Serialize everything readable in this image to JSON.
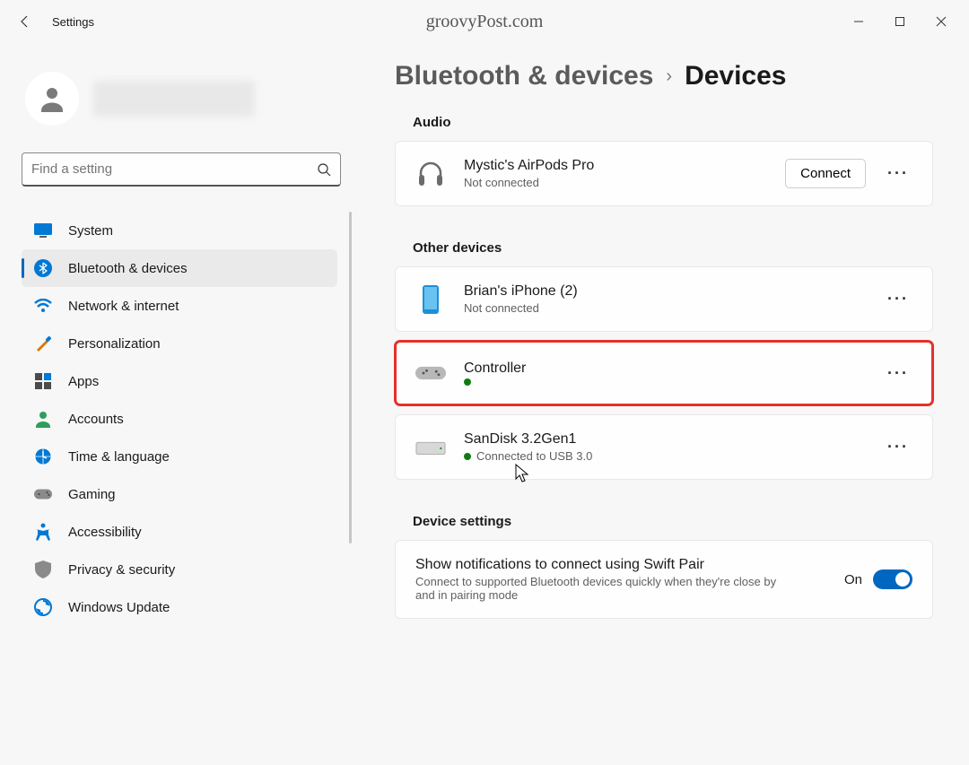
{
  "app_title": "Settings",
  "watermark": "groovyPost.com",
  "search": {
    "placeholder": "Find a setting"
  },
  "nav": {
    "items": [
      {
        "label": "System"
      },
      {
        "label": "Bluetooth & devices"
      },
      {
        "label": "Network & internet"
      },
      {
        "label": "Personalization"
      },
      {
        "label": "Apps"
      },
      {
        "label": "Accounts"
      },
      {
        "label": "Time & language"
      },
      {
        "label": "Gaming"
      },
      {
        "label": "Accessibility"
      },
      {
        "label": "Privacy & security"
      },
      {
        "label": "Windows Update"
      }
    ]
  },
  "breadcrumb": {
    "parent": "Bluetooth & devices",
    "current": "Devices"
  },
  "sections": {
    "audio": {
      "title": "Audio",
      "devices": [
        {
          "name": "Mystic's AirPods Pro",
          "status": "Not connected",
          "action": "Connect"
        }
      ]
    },
    "other": {
      "title": "Other devices",
      "devices": [
        {
          "name": "Brian's iPhone (2)",
          "status": "Not connected"
        },
        {
          "name": "Controller",
          "status": ""
        },
        {
          "name": "SanDisk 3.2Gen1",
          "status": "Connected to USB 3.0"
        }
      ]
    },
    "device_settings": {
      "title": "Device settings",
      "swift_pair": {
        "title": "Show notifications to connect using Swift Pair",
        "desc": "Connect to supported Bluetooth devices quickly when they're close by and in pairing mode",
        "state_label": "On"
      }
    }
  }
}
